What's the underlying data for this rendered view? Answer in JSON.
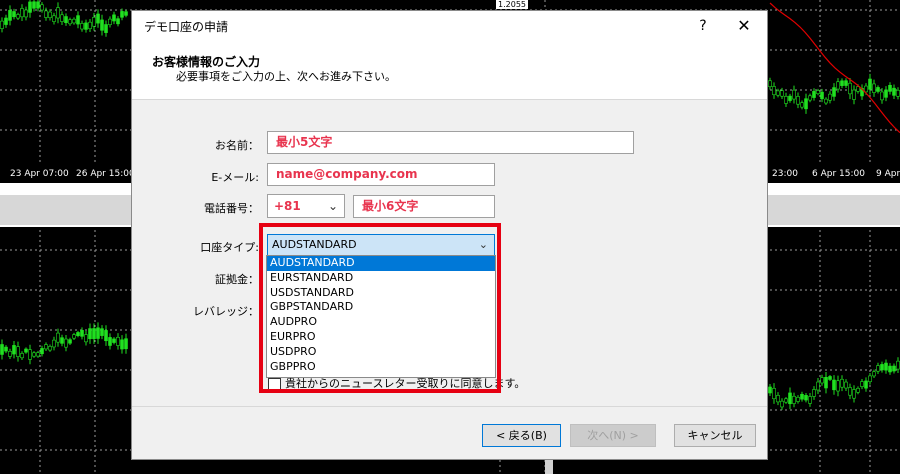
{
  "background": {
    "price_tag": "1.2055",
    "left_axis_labels": [
      "23 Apr 07:00",
      "26 Apr 15:00"
    ],
    "right_axis_labels": [
      "23:00",
      "6 Apr 15:00",
      "9 Apr"
    ]
  },
  "dialog": {
    "title": "デモ口座の申請",
    "help_label": "?",
    "close_label": "✕",
    "header_title": "お客様情報のご入力",
    "header_subtitle": "必要事項をご入力の上、次へお進み下さい。"
  },
  "form": {
    "name_label": "お名前：",
    "name_value": "最小5文字",
    "email_label": "E-メール:",
    "email_value": "name@company.com",
    "phone_label": "電話番号：",
    "phone_code": "+81",
    "phone_value": "最小6文字",
    "account_type_label": "口座タイプ:",
    "account_type_selected": "AUDSTANDARD",
    "deposit_label": "証拠金：",
    "leverage_label": "レバレッジ：",
    "account_type_options": [
      "AUDSTANDARD",
      "EURSTANDARD",
      "USDSTANDARD",
      "GBPSTANDARD",
      "AUDPRO",
      "EURPRO",
      "USDPRO",
      "GBPPRO"
    ],
    "newsletter_label": "貴社からのニュースレター受取りに同意します。"
  },
  "buttons": {
    "back": "< 戻る(B)",
    "next": "次へ(N) >",
    "cancel": "キャンセル"
  },
  "colors": {
    "highlight": "#e60012",
    "field_text": "#e8344e",
    "selection": "#0078d7"
  }
}
